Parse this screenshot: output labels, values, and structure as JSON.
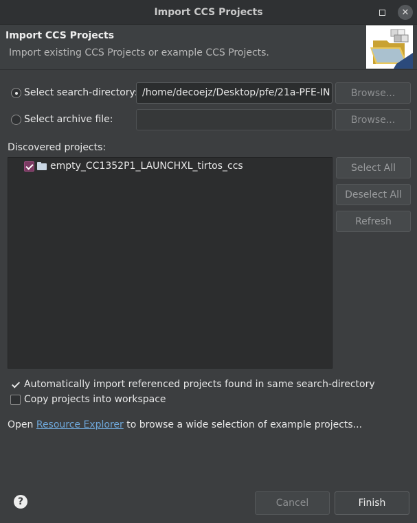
{
  "window": {
    "title": "Import CCS Projects"
  },
  "header": {
    "title": "Import CCS Projects",
    "subtitle": "Import existing CCS Projects or example CCS Projects."
  },
  "search_directory": {
    "label": "Select search-directory:",
    "value": "/home/decoejz/Desktop/pfe/21a-PFE-IN",
    "selected": true,
    "browse_label": "Browse..."
  },
  "archive_file": {
    "label": "Select archive file:",
    "value": "",
    "selected": false,
    "browse_label": "Browse..."
  },
  "discovered": {
    "label": "Discovered projects:",
    "projects": [
      {
        "name": "empty_CC1352P1_LAUNCHXL_tirtos_ccs",
        "checked": true
      }
    ],
    "select_all_label": "Select All",
    "deselect_all_label": "Deselect All",
    "refresh_label": "Refresh"
  },
  "options": {
    "auto_import_label": "Automatically import referenced projects found in same search-directory",
    "auto_import_checked": true,
    "copy_label": "Copy projects into workspace",
    "copy_checked": false
  },
  "footer_text": {
    "prefix": "Open ",
    "link": "Resource Explorer",
    "suffix": " to browse a wide selection of example projects..."
  },
  "buttons": {
    "help": "?",
    "cancel": "Cancel",
    "finish": "Finish"
  },
  "colors": {
    "background": "#3c3e40",
    "checkbox_accent": "#7b3a63",
    "link": "#6ea6d8"
  }
}
